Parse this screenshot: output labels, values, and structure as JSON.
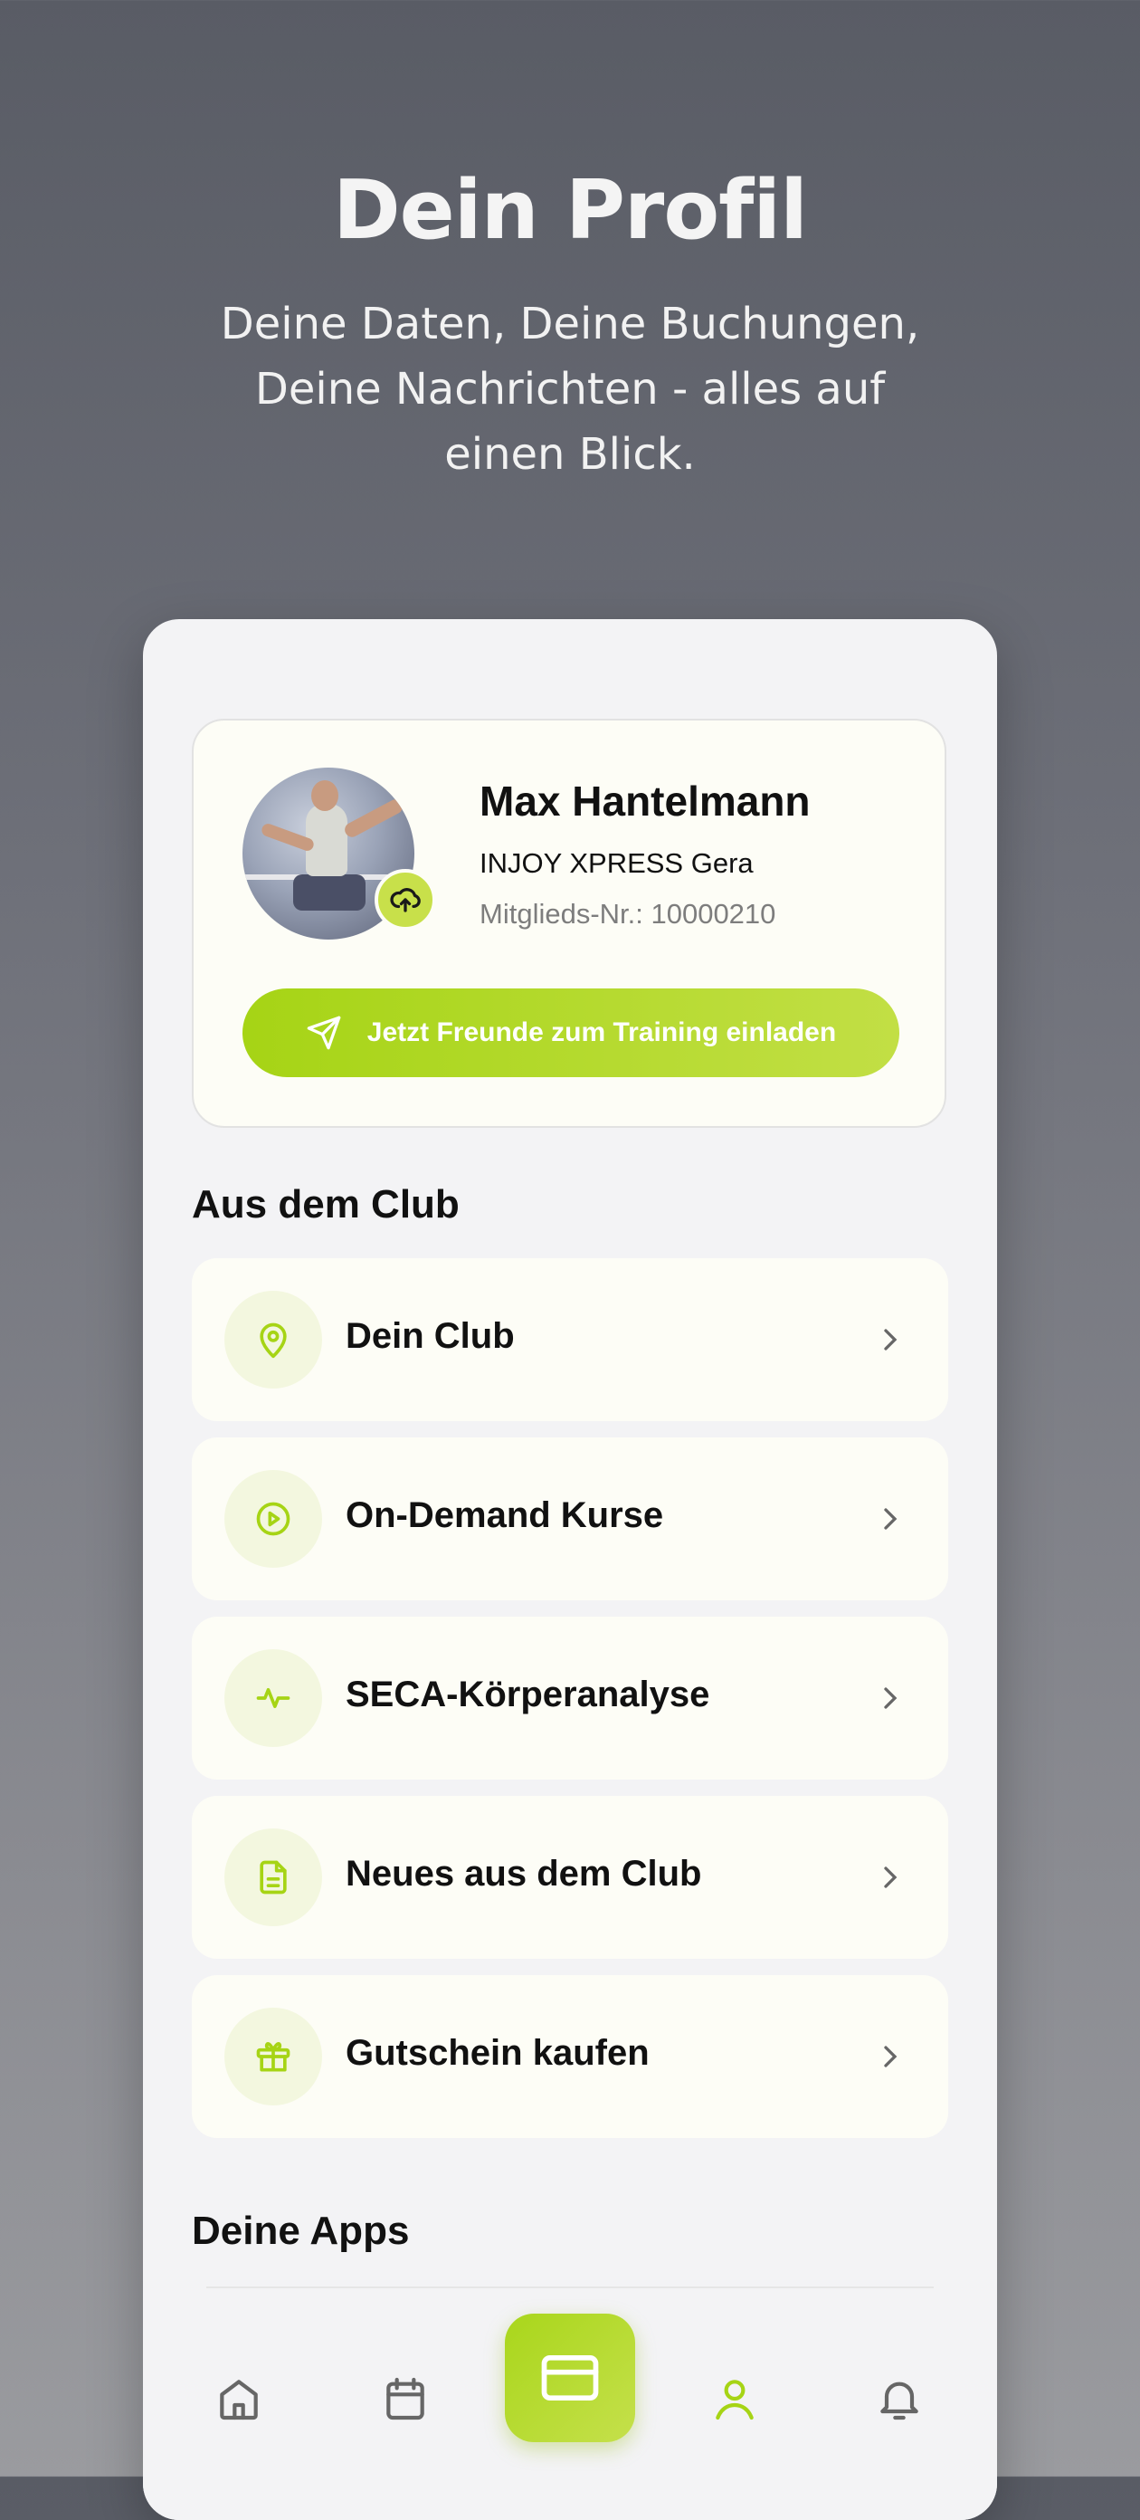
{
  "hero": {
    "title": "Dein Profil",
    "subtitle": "Deine Daten, Deine Buchungen, Deine Nachrichten - alles auf einen Blick."
  },
  "profile": {
    "name": "Max Hantelmann",
    "club": "INJOY XPRESS Gera",
    "member_number": "Mitglieds-Nr.: 10000210",
    "avatar_icon": "upload-cloud-icon",
    "invite_button": "Jetzt Freunde zum Training einladen"
  },
  "sections": {
    "club_title": "Aus dem Club",
    "apps_title": "Deine Apps"
  },
  "menu": [
    {
      "label": "Dein Club",
      "icon": "map-pin-icon"
    },
    {
      "label": "On-Demand Kurse",
      "icon": "play-circle-icon"
    },
    {
      "label": "SECA-Körperanalyse",
      "icon": "activity-icon"
    },
    {
      "label": "Neues aus dem Club",
      "icon": "document-icon"
    },
    {
      "label": "Gutschein kaufen",
      "icon": "gift-icon"
    }
  ],
  "bottom_nav": [
    {
      "icon": "home-icon",
      "active": false
    },
    {
      "icon": "calendar-icon",
      "active": false
    },
    {
      "icon": "card-icon",
      "active": false
    },
    {
      "icon": "user-icon",
      "active": true
    },
    {
      "icon": "bell-icon",
      "active": false
    }
  ],
  "colors": {
    "accent": "#a6d415",
    "accent_light": "#c8e04a",
    "icon_bg": "#f3f7df",
    "card_bg": "#fdfdf6",
    "text": "#111111",
    "muted": "#7d7d7d"
  }
}
